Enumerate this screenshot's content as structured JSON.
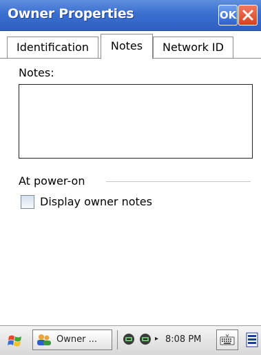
{
  "window": {
    "title": "Owner Properties",
    "ok_label": "OK",
    "close_icon": "close-icon"
  },
  "tabs": [
    {
      "label": "Identification",
      "active": false
    },
    {
      "label": "Notes",
      "active": true
    },
    {
      "label": "Network ID",
      "active": false
    }
  ],
  "notes": {
    "label": "Notes:",
    "value": ""
  },
  "power_on": {
    "section_label": "At power-on",
    "checkbox_label": "Display owner notes",
    "checked": false
  },
  "taskbar": {
    "start_icon": "windows-flag-icon",
    "task_label": "Owner ...",
    "task_icon": "users-icon",
    "tray_icons": [
      "network-icon",
      "network-icon"
    ],
    "tray_arrow": "▸",
    "clock": "8:08 PM",
    "keyboard_icon": "keyboard-icon",
    "desktop_icon": "desktop-icon"
  },
  "colors": {
    "title_bar": "#3a6fd0",
    "ok_button": "#2b5fd2",
    "close_button": "#d9401f"
  }
}
